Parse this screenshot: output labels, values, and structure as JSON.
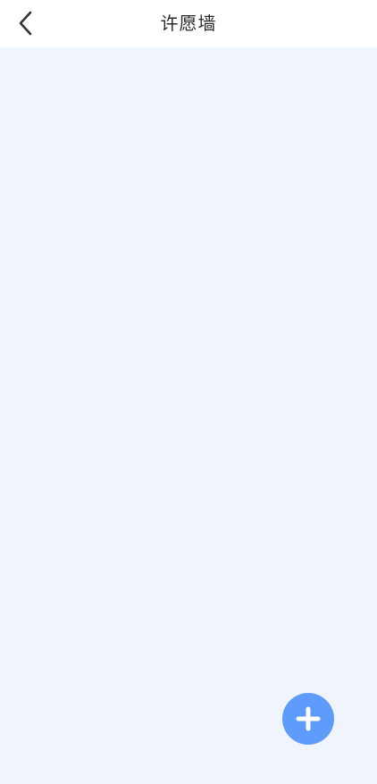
{
  "header": {
    "title": "许愿墙",
    "back_icon": "chevron-left-icon"
  },
  "fab": {
    "icon": "plus-icon",
    "color": "#5e9cfb"
  },
  "colors": {
    "background": "#f0f4fc",
    "navbar": "#ffffff",
    "title_text": "#2b2b2b"
  }
}
